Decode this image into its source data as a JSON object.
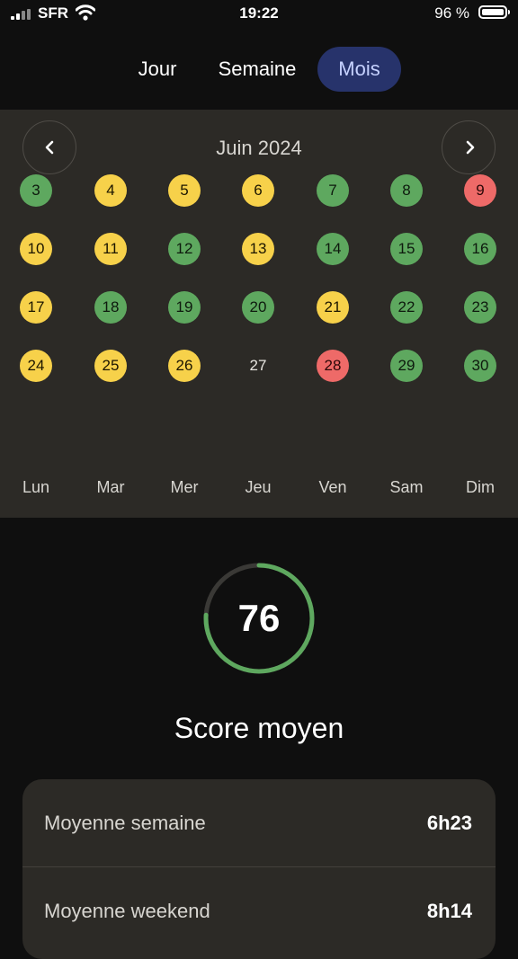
{
  "status_bar": {
    "carrier": "SFR",
    "time": "19:22",
    "battery": "96 %"
  },
  "tabs": [
    {
      "label": "Jour",
      "active": false
    },
    {
      "label": "Semaine",
      "active": false
    },
    {
      "label": "Mois",
      "active": true
    }
  ],
  "calendar": {
    "title": "Juin 2024",
    "weeks": [
      [
        {
          "d": "3",
          "c": "green"
        },
        {
          "d": "4",
          "c": "yellow"
        },
        {
          "d": "5",
          "c": "yellow"
        },
        {
          "d": "6",
          "c": "yellow"
        },
        {
          "d": "7",
          "c": "green"
        },
        {
          "d": "8",
          "c": "green"
        },
        {
          "d": "9",
          "c": "red"
        }
      ],
      [
        {
          "d": "10",
          "c": "yellow"
        },
        {
          "d": "11",
          "c": "yellow"
        },
        {
          "d": "12",
          "c": "green"
        },
        {
          "d": "13",
          "c": "yellow"
        },
        {
          "d": "14",
          "c": "green"
        },
        {
          "d": "15",
          "c": "green"
        },
        {
          "d": "16",
          "c": "green"
        }
      ],
      [
        {
          "d": "17",
          "c": "yellow"
        },
        {
          "d": "18",
          "c": "green"
        },
        {
          "d": "19",
          "c": "green"
        },
        {
          "d": "20",
          "c": "green"
        },
        {
          "d": "21",
          "c": "yellow"
        },
        {
          "d": "22",
          "c": "green"
        },
        {
          "d": "23",
          "c": "green"
        }
      ],
      [
        {
          "d": "24",
          "c": "yellow"
        },
        {
          "d": "25",
          "c": "yellow"
        },
        {
          "d": "26",
          "c": "yellow"
        },
        {
          "d": "27",
          "c": "none"
        },
        {
          "d": "28",
          "c": "red"
        },
        {
          "d": "29",
          "c": "green"
        },
        {
          "d": "30",
          "c": "green"
        }
      ]
    ],
    "weekdays": [
      "Lun",
      "Mar",
      "Mer",
      "Jeu",
      "Ven",
      "Sam",
      "Dim"
    ],
    "colors": {
      "green": "#5ea85f",
      "yellow": "#f7d14a",
      "red": "#ee6a68"
    }
  },
  "score": {
    "value": "76",
    "percent": 76,
    "label": "Score moyen",
    "ring_color": "#5ea85f"
  },
  "stats": [
    {
      "label": "Moyenne semaine",
      "value": "6h23"
    },
    {
      "label": "Moyenne weekend",
      "value": "8h14"
    }
  ]
}
